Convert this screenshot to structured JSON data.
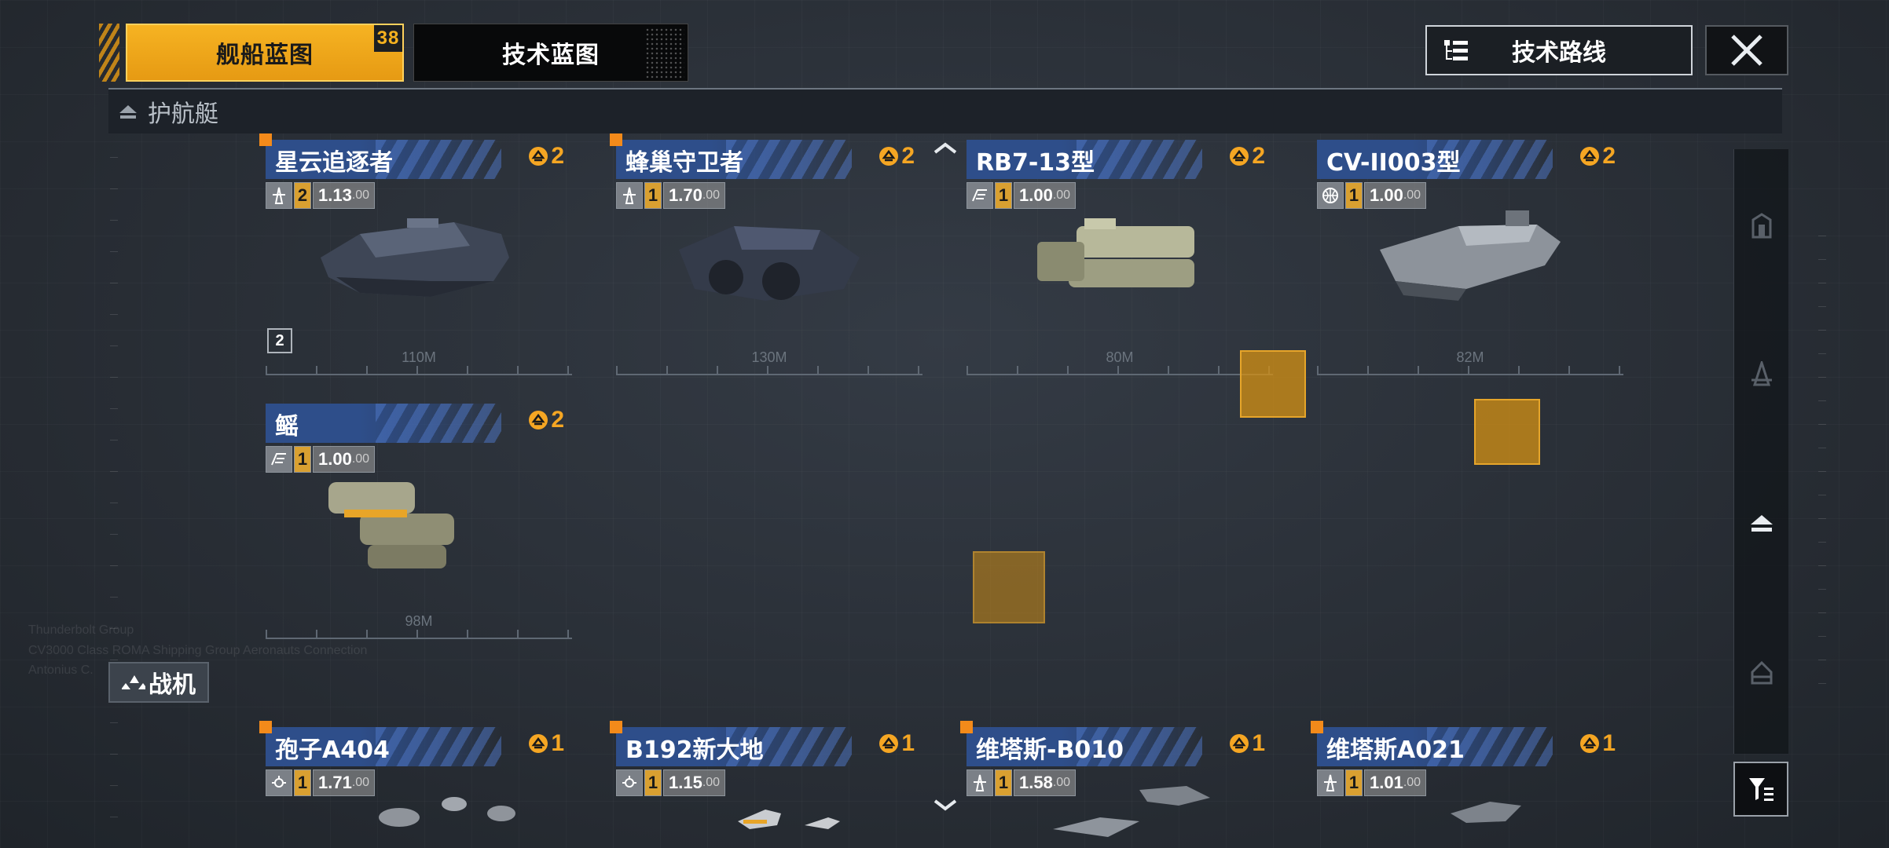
{
  "tabs": {
    "ship_blueprint": "舰船蓝图",
    "ship_blueprint_count": "38",
    "tech_blueprint": "技术蓝图"
  },
  "tech_route_label": "技术路线",
  "section_escort": "护航艇",
  "section_fighter": "战机",
  "cost_icon": "credit-chip-icon",
  "colors": {
    "accent": "#f5a623",
    "tab_active": "#f0a81c",
    "card_header": "#2e4e8a",
    "highlight": "#d69114"
  },
  "escorts": [
    {
      "name": "星云追逐者",
      "cost": "2",
      "stat_icon": "pylon-icon",
      "level": "2",
      "value": "1.13",
      "value_suffix": ".00",
      "length": "110M",
      "tier": "2",
      "new": true
    },
    {
      "name": "蜂巢守卫者",
      "cost": "2",
      "stat_icon": "pylon-icon",
      "level": "1",
      "value": "1.70",
      "value_suffix": ".00",
      "length": "130M",
      "new": true
    },
    {
      "name": "RB7-13型",
      "cost": "2",
      "stat_icon": "beam-icon",
      "level": "1",
      "value": "1.00",
      "value_suffix": ".00",
      "length": "80M",
      "new": false
    },
    {
      "name": "CV-II003型",
      "cost": "2",
      "stat_icon": "globe-icon",
      "level": "1",
      "value": "1.00",
      "value_suffix": ".00",
      "length": "82M",
      "new": false
    },
    {
      "name": "鳐",
      "cost": "2",
      "stat_icon": "beam-icon",
      "level": "1",
      "value": "1.00",
      "value_suffix": ".00",
      "length": "98M",
      "new": false
    }
  ],
  "fighters": [
    {
      "name": "孢子A404",
      "cost": "1",
      "stat_icon": "drone-icon",
      "level": "1",
      "value": "1.71",
      "value_suffix": ".00",
      "new": true
    },
    {
      "name": "B192新大地",
      "cost": "1",
      "stat_icon": "drone-icon",
      "level": "1",
      "value": "1.15",
      "value_suffix": ".00",
      "new": true
    },
    {
      "name": "维塔斯-B010",
      "cost": "1",
      "stat_icon": "pylon-icon",
      "level": "1",
      "value": "1.58",
      "value_suffix": ".00",
      "new": true
    },
    {
      "name": "维塔斯A021",
      "cost": "1",
      "stat_icon": "pylon-icon",
      "level": "1",
      "value": "1.01",
      "value_suffix": ".00",
      "new": true
    }
  ]
}
